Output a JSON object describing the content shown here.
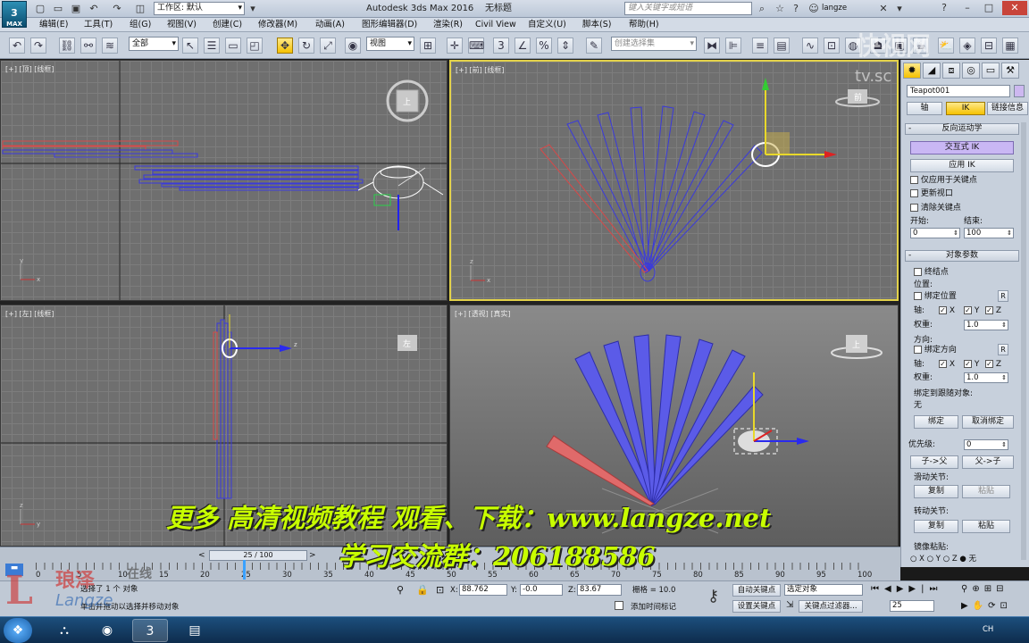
{
  "titlebar": {
    "logo": "3",
    "logo_sub": "MAX",
    "workspace": "工作区: 默认",
    "app_title": "Autodesk 3ds Max 2016",
    "file_name": "无标题",
    "search_placeholder": "键入关键字或短语",
    "user": "langze"
  },
  "menu": [
    "编辑(E)",
    "工具(T)",
    "组(G)",
    "视图(V)",
    "创建(C)",
    "修改器(M)",
    "动画(A)",
    "图形编辑器(D)",
    "渲染(R)",
    "Civil View",
    "自定义(U)",
    "脚本(S)",
    "帮助(H)"
  ],
  "toolbar": {
    "filter": "全部",
    "coord": "视图",
    "named_sel": "创建选择集"
  },
  "viewports": {
    "top": {
      "label": "[+] [顶] [线框]"
    },
    "front": {
      "label": "[+] [前] [线框]"
    },
    "left": {
      "label": "[+] [左] [线框]"
    },
    "persp": {
      "label": "[+] [透视] [真实]"
    }
  },
  "viewcube": {
    "top": "上",
    "front": "前",
    "left": "左",
    "persp": "上"
  },
  "axis": {
    "x": "x",
    "y": "y",
    "z": "z"
  },
  "command_panel": {
    "object_name": "Teapot001",
    "tabs": [
      "轴",
      "IK",
      "链接信息"
    ],
    "inverse_kin": {
      "title": "反向运动学",
      "interactive": "交互式 IK",
      "apply": "应用 IK",
      "only_keys": "仅应用于关键点",
      "update_vp": "更新视口",
      "clear_keys": "清除关键点",
      "start_label": "开始:",
      "end_label": "结束:",
      "start": "0",
      "end": "100"
    },
    "obj_params": {
      "title": "对象参数",
      "terminator": "终结点",
      "position": "位置:",
      "bind_pos": "绑定位置",
      "r": "R",
      "axis": "轴:",
      "x": "X",
      "y": "Y",
      "z": "Z",
      "weight": "权重:",
      "weight_val": "1.0",
      "orientation": "方向:",
      "bind_orient": "绑定方向",
      "bind_follow": "绑定到跟随对象:",
      "none": "无",
      "bind": "绑定",
      "unbind": "取消绑定",
      "precedence": "优先级:",
      "prec_val": "0",
      "child_parent": "子->父",
      "parent_child": "父->子",
      "sliding": "滑动关节:",
      "copy": "复制",
      "paste": "粘贴",
      "rotational": "转动关节:",
      "mirror": "镜像粘贴:",
      "mx": "X",
      "my": "Y",
      "mz": "Z",
      "mnone": "无"
    }
  },
  "timeline": {
    "slider": "25 / 100",
    "ticks": [
      "0",
      "5",
      "10",
      "15",
      "20",
      "25",
      "30",
      "35",
      "40",
      "45",
      "50",
      "55",
      "60",
      "65",
      "70",
      "75",
      "80",
      "85",
      "90",
      "95",
      "100"
    ]
  },
  "status": {
    "selected": "选择了 1 个 对象",
    "prompt": "单击并拖动以选择并移动对象",
    "x_label": "X:",
    "x": "88.762",
    "y_label": "Y:",
    "y": "-0.0",
    "z_label": "Z:",
    "z": "83.67",
    "grid": "栅格 = 10.0",
    "add_time_tag": "添加时间标记",
    "auto_key": "自动关键点",
    "set_key": "设置关键点",
    "selected_obj": "选定对象",
    "key_filters": "关键点过滤器...",
    "frame": "25"
  },
  "overlay": {
    "line1": "更多 高清视频教程 观看、下载：www.langze.net",
    "line2": "学习交流群：206188586"
  },
  "watermark": {
    "line1": "快视网",
    "line2": "tv.sc"
  },
  "brand": {
    "mark": "L",
    "name": "琅泽",
    "online": "在线",
    "sub": "Langze"
  },
  "taskbar": {
    "clock": "CH"
  },
  "colors": {
    "ik_purple": "#c9b7f4",
    "bone_blue": "#3a3adc",
    "bone_red": "#d84848",
    "active_yellow": "#e3d24a"
  }
}
